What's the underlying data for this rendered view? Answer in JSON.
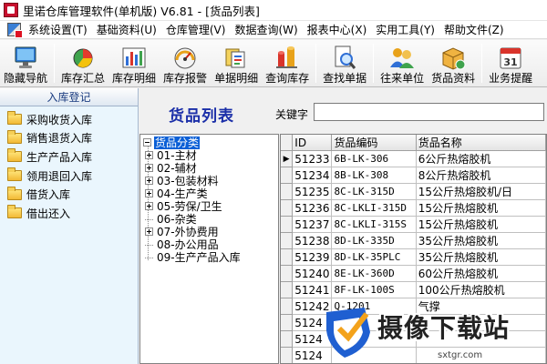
{
  "window": {
    "title": "里诺仓库管理软件(单机版) V6.81 - [货品列表]"
  },
  "menu": [
    "系统设置(T)",
    "基础资料(U)",
    "仓库管理(V)",
    "数据查询(W)",
    "报表中心(X)",
    "实用工具(Y)",
    "帮助文件(Z)"
  ],
  "toolbar": {
    "hide_nav": "隐藏导航",
    "stock_summary": "库存汇总",
    "stock_detail": "库存明细",
    "stock_alert": "库存报警",
    "doc_detail": "单据明细",
    "query_stock": "查询库存",
    "find_doc": "查找单据",
    "partners": "往来单位",
    "goods_info": "货品资料",
    "reminder": "业务提醒",
    "calendar_day": "31"
  },
  "nav": {
    "header": "入库登记",
    "items": [
      "采购收货入库",
      "销售退货入库",
      "生产产品入库",
      "领用退回入库",
      "借货入库",
      "借出还入"
    ]
  },
  "main": {
    "title": "货品列表",
    "keyword_label": "关键字",
    "keyword_value": ""
  },
  "tree": {
    "root": "货品分类",
    "nodes": [
      {
        "label": "01-主材",
        "expandable": true
      },
      {
        "label": "02-辅材",
        "expandable": true
      },
      {
        "label": "03-包装材料",
        "expandable": true
      },
      {
        "label": "04-生产类",
        "expandable": true
      },
      {
        "label": "05-劳保/卫生",
        "expandable": true
      },
      {
        "label": "06-杂类",
        "expandable": false
      },
      {
        "label": "07-外协费用",
        "expandable": true
      },
      {
        "label": "08-办公用品",
        "expandable": false
      },
      {
        "label": "09-生产产品入库",
        "expandable": false
      }
    ]
  },
  "grid": {
    "columns": [
      "ID",
      "货品编码",
      "货品名称"
    ],
    "rows": [
      {
        "id": "51233",
        "code": "6B-LK-306",
        "name": "6公斤热熔胶机"
      },
      {
        "id": "51234",
        "code": "8B-LK-308",
        "name": "8公斤热熔胶机"
      },
      {
        "id": "51235",
        "code": "8C-LK-315D",
        "name": "15公斤热熔胶机/日"
      },
      {
        "id": "51236",
        "code": "8C-LKLI-315D",
        "name": "15公斤热熔胶机"
      },
      {
        "id": "51237",
        "code": "8C-LKLI-315S",
        "name": "15公斤热熔胶机"
      },
      {
        "id": "51238",
        "code": "8D-LK-335D",
        "name": "35公斤热熔胶机"
      },
      {
        "id": "51239",
        "code": "8D-LK-35PLC",
        "name": "35公斤热熔胶机"
      },
      {
        "id": "51240",
        "code": "8E-LK-360D",
        "name": "60公斤热熔胶机"
      },
      {
        "id": "51241",
        "code": "8F-LK-100S",
        "name": "100公斤热熔胶机"
      },
      {
        "id": "51242",
        "code": "Q-1201",
        "name": "气撑"
      },
      {
        "id": "5124",
        "code": "",
        "name": ""
      },
      {
        "id": "5124",
        "code": "",
        "name": ""
      },
      {
        "id": "5124",
        "code": "",
        "name": ""
      },
      {
        "id": "5124",
        "code": "",
        "name": ""
      }
    ],
    "current_row_marker": "▶"
  },
  "watermark": {
    "text": "摄像下载站",
    "url": "sxtgr.com"
  },
  "colors": {
    "accent": "#0a5fd6",
    "title_blue": "#1a2ea8",
    "nav_bg": "#eaf6fd"
  }
}
